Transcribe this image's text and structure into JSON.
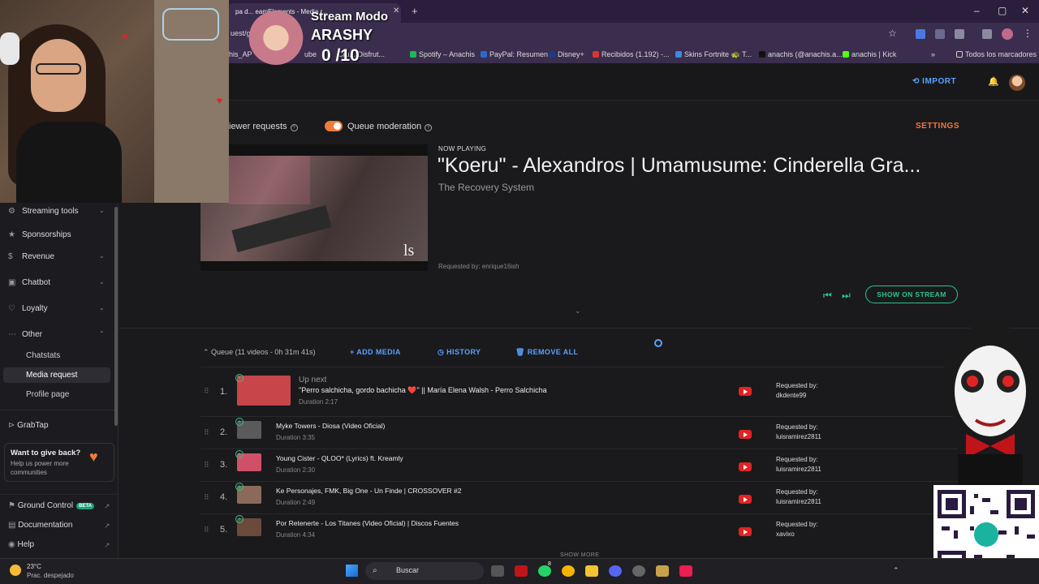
{
  "browser": {
    "tab_title": "pa d... eamElements - Media r...",
    "url": "uest/g",
    "bookmarks": [
      "his_AP",
      "ube",
      "Cru... Disfrut...",
      "Spotify – Anachis",
      "PayPal: Resumen",
      "Disney+",
      "Recibidos (1.192) -...",
      "Skins Fortnite 🐢 T...",
      "anachis (@anachis.a...",
      "anachis | Kick",
      "Todos los marcadores"
    ],
    "bookmarks_more": "»",
    "new_tab": "+"
  },
  "header": {
    "import_label": "IMPORT"
  },
  "sidebar": {
    "items": [
      {
        "label": "Streaming tools",
        "icon": "tools-icon"
      },
      {
        "label": "Sponsorships",
        "icon": "star-icon"
      },
      {
        "label": "Revenue",
        "icon": "dollar-icon"
      },
      {
        "label": "Chatbot",
        "icon": "chat-icon"
      },
      {
        "label": "Loyalty",
        "icon": "heart-icon"
      },
      {
        "label": "Other",
        "icon": "dots-icon"
      }
    ],
    "sub_items": [
      "Chatstats",
      "Media request",
      "Profile page"
    ],
    "grabtap": "GrabTap",
    "give_back_title": "Want to give back?",
    "give_back_text_1": "Help us power more",
    "give_back_text_2": "communities",
    "ground_control": "Ground Control",
    "beta": "BETA",
    "documentation": "Documentation",
    "help": "Help"
  },
  "controls": {
    "viewer_requests": "iewer requests",
    "queue_moderation": "Queue moderation",
    "queue_moderation_on": true,
    "settings": "SETTINGS"
  },
  "now_playing": {
    "label": "NOW PLAYING",
    "title": "\"Koeru\" - Alexandros | Umamusume: Cinderella Gra...",
    "artist": "The Recovery System",
    "requested_by": "Requested by: enrique16ish",
    "show_on_stream": "SHOW ON STREAM"
  },
  "queue": {
    "summary": "Queue (11 videos - 0h 31m 41s)",
    "add_media": "ADD MEDIA",
    "history": "HISTORY",
    "remove_all": "REMOVE ALL",
    "up_next": "Up next",
    "requested_label": "Requested by:",
    "show_more": "SHOW MORE",
    "items": [
      {
        "num": "1.",
        "title": "\"Perro salchicha, gordo bachicha ❤️\" || María Elena Walsh - Perro Salchicha",
        "duration": "Duration 2:17",
        "requester": "dkdente99",
        "thumb": "#c8464a"
      },
      {
        "num": "2.",
        "title": "Myke Towers - Diosa (Video Oficial)",
        "duration": "Duration 3:35",
        "requester": "luisramirez2811",
        "thumb": "#5a5a5a"
      },
      {
        "num": "3.",
        "title": "Young Cister - QLOO* (Lyrics) ft. Kreamly",
        "duration": "Duration 2:30",
        "requester": "luisramirez2811",
        "thumb": "#d0506a"
      },
      {
        "num": "4.",
        "title": "Ke Personajes, FMK, Big One - Un Finde | CROSSOVER #2",
        "duration": "Duration 2:49",
        "requester": "luisramirez2811",
        "thumb": "#8a6a5a"
      },
      {
        "num": "5.",
        "title": "Por Retenerte - Los Titanes (Video Oficial) | Discos Fuentes",
        "duration": "Duration 4:34",
        "requester": "xavixo",
        "thumb": "#6a4a3a"
      }
    ]
  },
  "overlay": {
    "stream_mode": "Stream Modo",
    "name": "ARASHY",
    "count": "0 /10"
  },
  "taskbar": {
    "temp": "23°C",
    "weather": "Prac. despejado",
    "search": "Buscar",
    "badge": "8"
  }
}
